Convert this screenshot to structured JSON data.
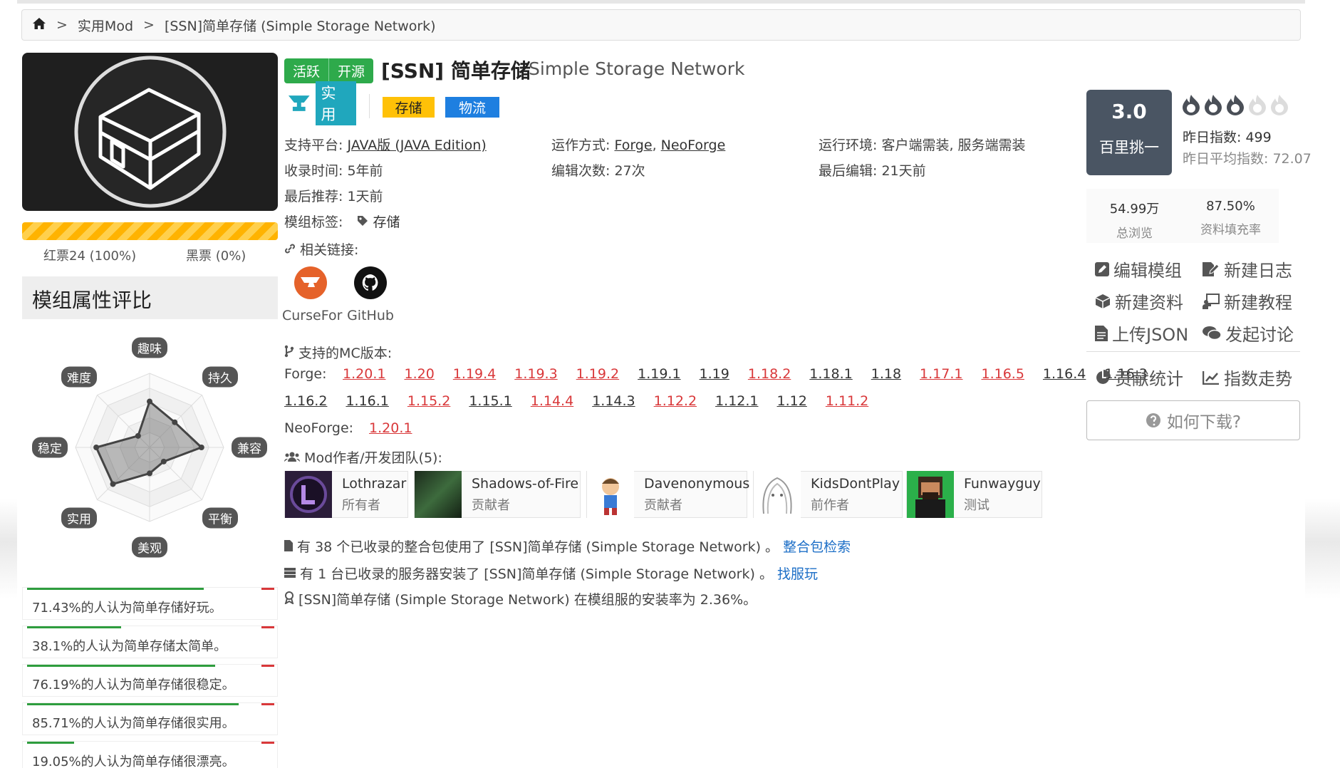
{
  "breadcrumb": {
    "category": "实用Mod",
    "current": "[SSN]简单存储 (Simple Storage Network)"
  },
  "mod": {
    "status_active": "活跃",
    "status_open": "开源",
    "title": "[SSN] 简单存储",
    "subtitle": "Simple Storage Network",
    "category_main": "实用",
    "tags": [
      {
        "label": "存储",
        "color": "#ffc107"
      },
      {
        "label": "物流",
        "color": "#1e7fe0"
      }
    ],
    "platform_label": "支持平台:",
    "platform_value": "JAVA版 (JAVA Edition)",
    "runmode_label": "运作方式:",
    "runmode_forge": "Forge",
    "runmode_neoforge": "NeoForge",
    "env_label": "运行环境:",
    "env_value": "客户端需装, 服务端需装",
    "collect_label": "收录时间:",
    "collect_value": "5年前",
    "edits_label": "编辑次数:",
    "edits_value": "27次",
    "lastedit_label": "最后编辑:",
    "lastedit_value": "21天前",
    "recommend_label": "最后推荐:",
    "recommend_value": "1天前",
    "modtags_label": "模组标签:",
    "modtags_value": "存储",
    "links_label": "相关链接:",
    "links": [
      {
        "label": "CurseFor",
        "icon": "curseforge-icon"
      },
      {
        "label": "GitHub",
        "icon": "github-icon"
      }
    ],
    "mc_label": "支持的MC版本:",
    "forge_label": "Forge:",
    "forge_row1": [
      {
        "v": "1.20.1",
        "rec": true
      },
      {
        "v": "1.20",
        "rec": true
      },
      {
        "v": "1.19.4",
        "rec": true
      },
      {
        "v": "1.19.3",
        "rec": true
      },
      {
        "v": "1.19.2",
        "rec": true
      },
      {
        "v": "1.19.1",
        "rec": false
      },
      {
        "v": "1.19",
        "rec": false
      },
      {
        "v": "1.18.2",
        "rec": true
      },
      {
        "v": "1.18.1",
        "rec": false
      },
      {
        "v": "1.18",
        "rec": false
      },
      {
        "v": "1.17.1",
        "rec": true
      },
      {
        "v": "1.16.5",
        "rec": true
      },
      {
        "v": "1.16.4",
        "rec": false
      },
      {
        "v": "1.16.3",
        "rec": false
      }
    ],
    "forge_row2": [
      {
        "v": "1.16.2",
        "rec": false
      },
      {
        "v": "1.16.1",
        "rec": false
      },
      {
        "v": "1.15.2",
        "rec": true
      },
      {
        "v": "1.15.1",
        "rec": false
      },
      {
        "v": "1.14.4",
        "rec": true
      },
      {
        "v": "1.14.3",
        "rec": false
      },
      {
        "v": "1.12.2",
        "rec": true
      },
      {
        "v": "1.12.1",
        "rec": false
      },
      {
        "v": "1.12",
        "rec": false
      },
      {
        "v": "1.11.2",
        "rec": true
      }
    ],
    "neoforge_label": "NeoForge:",
    "neoforge": [
      {
        "v": "1.20.1",
        "rec": true
      }
    ],
    "team_label": "Mod作者/开发团队(5):",
    "authors": [
      {
        "name": "Lothrazar",
        "role": "所有者"
      },
      {
        "name": "Shadows-of-Fire",
        "role": "贡献者"
      },
      {
        "name": "Davenonymous",
        "role": "贡献者"
      },
      {
        "name": "KidsDontPlay",
        "role": "前作者"
      },
      {
        "name": "Funwayguy",
        "role": "测试"
      }
    ],
    "modpack_text": "有 38 个已收录的整合包使用了 [SSN]简单存储 (Simple Storage Network) 。",
    "modpack_link": "整合包检索",
    "server_text": "有 1 台已收录的服务器安装了 [SSN]简单存储 (Simple Storage Network) 。",
    "server_link": "找服玩",
    "install_text": "[SSN]简单存储 (Simple Storage Network) 在模组服的安装率为 2.36%。"
  },
  "votes": {
    "red": "红票24 (100%)",
    "black": "黑票 (0%)",
    "red_fraction": 1.0
  },
  "attributes": {
    "title": "模组属性评比",
    "labels": [
      "趣味",
      "持久",
      "兼容",
      "平衡",
      "美观",
      "实用",
      "稳定",
      "难度"
    ],
    "values": [
      0.62,
      0.48,
      0.7,
      0.27,
      0.35,
      0.7,
      0.72,
      0.22
    ],
    "opinions": [
      {
        "text": "71.43%的人认为简单存储好玩。",
        "value": 0.7143
      },
      {
        "text": "38.1%的人认为简单存储太简单。",
        "value": 0.381
      },
      {
        "text": "76.19%的人认为简单存储很稳定。",
        "value": 0.7619
      },
      {
        "text": "85.71%的人认为简单存储很实用。",
        "value": 0.8571
      },
      {
        "text": "19.05%的人认为简单存储很漂亮。",
        "value": 0.1905
      }
    ]
  },
  "score": {
    "value": "3.0",
    "level": "百里挑一",
    "flames_filled": 3,
    "flames_total": 5,
    "yesterday": "昨日指数: 499",
    "yesterday_avg": "昨日平均指数: 72.07",
    "views": "54.99万",
    "views_label": "总浏览",
    "fill": "87.50%",
    "fill_label": "资料填充率"
  },
  "actions": {
    "edit": "编辑模组",
    "newlog": "新建日志",
    "newdata": "新建资料",
    "newtutorial": "新建教程",
    "upload": "上传JSON",
    "discuss": "发起讨论",
    "contrib": "贡献统计",
    "trend": "指数走势",
    "howto": "如何下载?"
  },
  "colors": {
    "active": "#2eaa4b",
    "recommended_version": "#d9383a",
    "link": "#1d6fc7",
    "score_box": "#4a5563"
  }
}
